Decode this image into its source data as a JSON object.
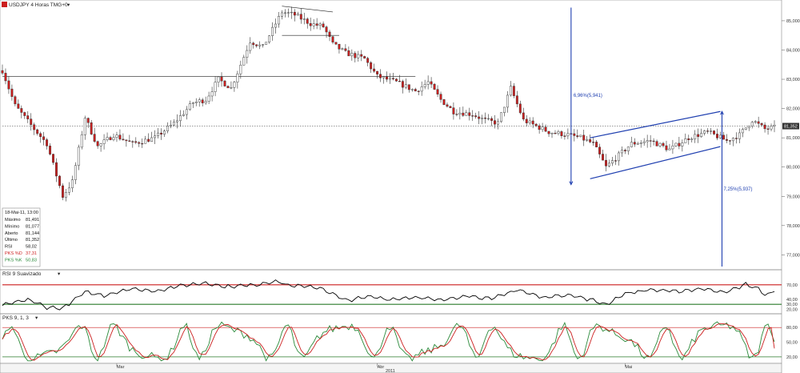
{
  "header": {
    "symbol_label": "USDJPY 4 Horas TMG+0"
  },
  "colors": {
    "up_candle": "#ffffff",
    "down_candle": "#cc1e1e",
    "candle_outline": "#333333",
    "channel": "#1f3fb0",
    "rsi_line": "#000000",
    "stoch_k": "#2a8a3a",
    "stoch_d": "#cc1e1e",
    "level_high": "#cc1e1e",
    "level_low": "#2a7a2a",
    "price_marker_bg": "#333333"
  },
  "chart_data": [
    {
      "type": "candlestick",
      "title": "USDJPY 4 Horas TMG+0",
      "ylim": [
        76.6,
        85.6
      ],
      "y_ticks": [
        "85,000",
        "84,000",
        "83,000",
        "82,000",
        "81,000",
        "80,000",
        "79,000",
        "78,000",
        "77,000"
      ],
      "x_ticks": [
        "Mar",
        "Abr",
        "Mai"
      ],
      "x_year": "2011",
      "grid": false,
      "current_price": "81,352",
      "key": [
        {
          "x": 0,
          "y": 83.3
        },
        {
          "x": 4,
          "y": 82.1
        },
        {
          "x": 10,
          "y": 81.3
        },
        {
          "x": 14,
          "y": 80.8
        },
        {
          "x": 19,
          "y": 79.0
        },
        {
          "x": 22,
          "y": 79.5
        },
        {
          "x": 26,
          "y": 81.7
        },
        {
          "x": 30,
          "y": 80.7
        },
        {
          "x": 35,
          "y": 81.1
        },
        {
          "x": 41,
          "y": 80.8
        },
        {
          "x": 48,
          "y": 81.0
        },
        {
          "x": 54,
          "y": 81.5
        },
        {
          "x": 60,
          "y": 82.2
        },
        {
          "x": 64,
          "y": 82.3
        },
        {
          "x": 68,
          "y": 83.0
        },
        {
          "x": 72,
          "y": 82.7
        },
        {
          "x": 78,
          "y": 84.3
        },
        {
          "x": 82,
          "y": 84.1
        },
        {
          "x": 88,
          "y": 85.3
        },
        {
          "x": 92,
          "y": 85.2
        },
        {
          "x": 97,
          "y": 84.9
        },
        {
          "x": 101,
          "y": 84.8
        },
        {
          "x": 104,
          "y": 84.2
        },
        {
          "x": 108,
          "y": 83.9
        },
        {
          "x": 114,
          "y": 83.7
        },
        {
          "x": 118,
          "y": 83.1
        },
        {
          "x": 124,
          "y": 82.9
        },
        {
          "x": 130,
          "y": 82.6
        },
        {
          "x": 134,
          "y": 82.9
        },
        {
          "x": 138,
          "y": 82.3
        },
        {
          "x": 142,
          "y": 81.9
        },
        {
          "x": 148,
          "y": 81.8
        },
        {
          "x": 152,
          "y": 81.6
        },
        {
          "x": 156,
          "y": 81.5
        },
        {
          "x": 160,
          "y": 82.7
        },
        {
          "x": 164,
          "y": 81.6
        },
        {
          "x": 168,
          "y": 81.4
        },
        {
          "x": 172,
          "y": 81.2
        },
        {
          "x": 178,
          "y": 81.1
        },
        {
          "x": 182,
          "y": 81.0
        },
        {
          "x": 186,
          "y": 80.8
        },
        {
          "x": 190,
          "y": 80.0
        },
        {
          "x": 194,
          "y": 80.4
        },
        {
          "x": 198,
          "y": 80.8
        },
        {
          "x": 204,
          "y": 80.9
        },
        {
          "x": 210,
          "y": 80.6
        },
        {
          "x": 216,
          "y": 81.0
        },
        {
          "x": 222,
          "y": 81.2
        },
        {
          "x": 228,
          "y": 80.9
        },
        {
          "x": 232,
          "y": 81.1
        },
        {
          "x": 236,
          "y": 81.6
        },
        {
          "x": 240,
          "y": 81.3
        },
        {
          "x": 243,
          "y": 81.352
        }
      ],
      "bar_count": 244,
      "price_levels": [
        83.1,
        81.4
      ],
      "annotations": [
        "6,96%(5,941)",
        "7,25%(5,937)"
      ],
      "info_box": {
        "date": "18-Mai-11, 13:00",
        "rows": [
          {
            "label": "Máximo",
            "value": "81,491"
          },
          {
            "label": "Mínimo",
            "value": "81,077"
          },
          {
            "label": "Aberto",
            "value": "81,144"
          },
          {
            "label": "Último",
            "value": "81,352"
          },
          {
            "label": "RSI",
            "value": "58,02"
          },
          {
            "label": "PKS %D",
            "value": "37,31"
          },
          {
            "label": "PKS %K",
            "value": "50,83"
          }
        ]
      }
    },
    {
      "type": "line",
      "title": "RSI 9 Suavizado",
      "ylim": [
        14,
        86
      ],
      "levels": [
        70,
        30
      ],
      "y_ticks": [
        "70,00",
        "40,00",
        "30,00",
        "20,00"
      ],
      "key": [
        {
          "x": 0,
          "y": 28
        },
        {
          "x": 8,
          "y": 40
        },
        {
          "x": 14,
          "y": 24
        },
        {
          "x": 19,
          "y": 22
        },
        {
          "x": 26,
          "y": 55
        },
        {
          "x": 32,
          "y": 48
        },
        {
          "x": 40,
          "y": 62
        },
        {
          "x": 48,
          "y": 57
        },
        {
          "x": 56,
          "y": 68
        },
        {
          "x": 64,
          "y": 74
        },
        {
          "x": 70,
          "y": 66
        },
        {
          "x": 80,
          "y": 70
        },
        {
          "x": 86,
          "y": 78
        },
        {
          "x": 90,
          "y": 69
        },
        {
          "x": 100,
          "y": 64
        },
        {
          "x": 108,
          "y": 38
        },
        {
          "x": 116,
          "y": 46
        },
        {
          "x": 122,
          "y": 40
        },
        {
          "x": 130,
          "y": 45
        },
        {
          "x": 138,
          "y": 38
        },
        {
          "x": 146,
          "y": 48
        },
        {
          "x": 154,
          "y": 41
        },
        {
          "x": 162,
          "y": 60
        },
        {
          "x": 170,
          "y": 44
        },
        {
          "x": 178,
          "y": 50
        },
        {
          "x": 186,
          "y": 38
        },
        {
          "x": 190,
          "y": 30
        },
        {
          "x": 196,
          "y": 52
        },
        {
          "x": 204,
          "y": 60
        },
        {
          "x": 212,
          "y": 56
        },
        {
          "x": 220,
          "y": 62
        },
        {
          "x": 228,
          "y": 55
        },
        {
          "x": 234,
          "y": 71
        },
        {
          "x": 238,
          "y": 62
        },
        {
          "x": 240,
          "y": 48
        },
        {
          "x": 243,
          "y": 58
        }
      ],
      "bar_count": 244
    },
    {
      "type": "line",
      "title": "PKS 9, 1, 3",
      "ylim": [
        10,
        95
      ],
      "levels": [
        80,
        20
      ],
      "y_ticks": [
        "80,00",
        "50,00",
        "20,00"
      ],
      "series": [
        {
          "name": "PKS %K",
          "period": 17,
          "amplitude": 34,
          "last": 50.83
        },
        {
          "name": "PKS %D",
          "period": 17,
          "amplitude": 30,
          "last": 37.31
        }
      ],
      "bar_count": 244
    }
  ]
}
